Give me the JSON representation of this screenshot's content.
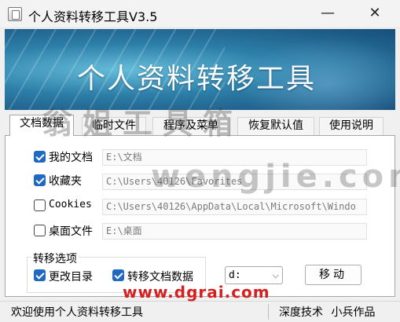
{
  "window": {
    "title": "个人资料转移工具V3.5",
    "minimize_glyph": "—",
    "close_glyph": "✕"
  },
  "banner": {
    "title": "个人资料转移工具"
  },
  "watermarks": {
    "top": "翁姐工具箱",
    "middle": "wengjie.com",
    "bottom": "www.dgrai.com"
  },
  "tabs": [
    {
      "label": "文档数据",
      "active": true
    },
    {
      "label": "临时文件",
      "active": false
    },
    {
      "label": "程序及菜单",
      "active": false
    },
    {
      "label": "恢复默认值",
      "active": false
    },
    {
      "label": "使用说明",
      "active": false
    }
  ],
  "items": [
    {
      "label": "我的文档",
      "checked": true,
      "path": "E:\\文档"
    },
    {
      "label": "收藏夹",
      "checked": true,
      "path": "C:\\Users\\40126\\Favorites"
    },
    {
      "label": "Cookies",
      "checked": false,
      "path": "C:\\Users\\40126\\AppData\\Local\\Microsoft\\Windo"
    },
    {
      "label": "桌面文件",
      "checked": false,
      "path": "E:\\桌面"
    }
  ],
  "options": {
    "legend": "转移选项",
    "change_dir": {
      "label": "更改目录",
      "checked": true
    },
    "move_data": {
      "label": "转移文档数据",
      "checked": true
    }
  },
  "drive": {
    "value": "d:",
    "arrow": "⌵"
  },
  "move_button": {
    "label": "移动"
  },
  "status": {
    "left": "欢迎使用个人资料转移工具",
    "right": "深度技术 小兵作品"
  }
}
